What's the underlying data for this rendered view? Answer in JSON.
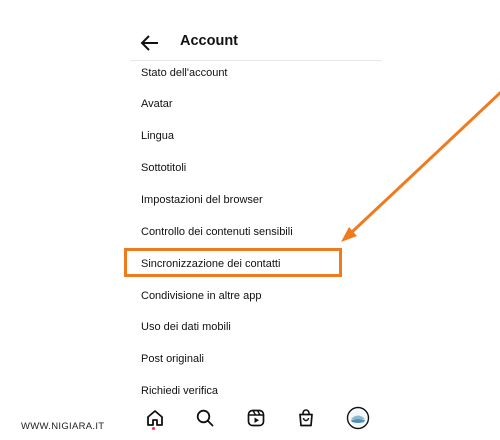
{
  "header": {
    "title": "Account",
    "back_icon": "back-arrow-icon"
  },
  "menu": {
    "items": [
      {
        "label": "Stato dell'account"
      },
      {
        "label": "Avatar"
      },
      {
        "label": "Lingua"
      },
      {
        "label": "Sottotitoli"
      },
      {
        "label": "Impostazioni del browser"
      },
      {
        "label": "Controllo dei contenuti sensibili"
      },
      {
        "label": "Sincronizzazione dei contatti",
        "highlighted": true
      },
      {
        "label": "Condivisione in altre app"
      },
      {
        "label": "Uso dei dati mobili"
      },
      {
        "label": "Post originali"
      },
      {
        "label": "Richiedi verifica"
      }
    ]
  },
  "annotation": {
    "highlight_color": "#f07b1f"
  },
  "bottom_nav": {
    "icons": [
      "home-icon",
      "search-icon",
      "reels-icon",
      "shop-icon",
      "profile-avatar-icon"
    ],
    "active": "home-icon"
  },
  "watermark": {
    "text": "WWW.NIGIARA.IT"
  }
}
